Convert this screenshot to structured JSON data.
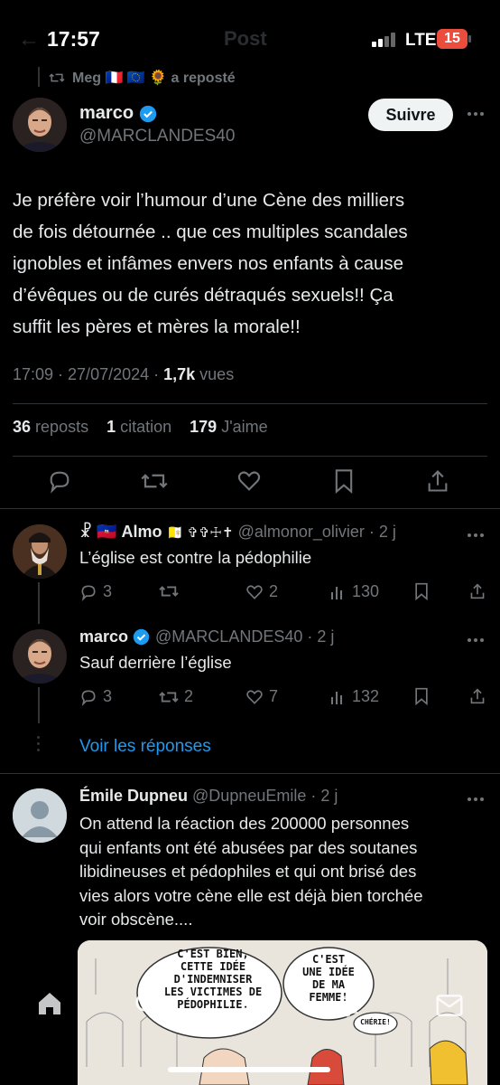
{
  "status_bar": {
    "time": "17:57",
    "network": "LTE",
    "battery": "15"
  },
  "header": {
    "title_faded": "Post"
  },
  "repost_banner": {
    "text": "Meg 🇫🇷 🇪🇺 🌻 a reposté"
  },
  "main_post": {
    "author_name": "marco",
    "author_handle": "@MARCLANDES40",
    "follow_label": "Suivre",
    "text_lines": [
      "Je préfère voir l’humour d’une Cène des milliers",
      "de fois détournée .. que ces multiples scandales",
      "ignobles et infâmes envers nos enfants à cause",
      "d’évêques ou de curés détraqués sexuels!! Ça",
      "suffit les pères et mères la morale!!"
    ],
    "timestamp": "17:09 · 27/07/2024 · ",
    "views_count": "1,7k",
    "views_label": " vues",
    "stats": {
      "reposts_count": "36",
      "reposts_label": "reposts",
      "quotes_count": "1",
      "quotes_label": "citation",
      "likes_count": "179",
      "likes_label": "J'aime"
    }
  },
  "replies": [
    {
      "prefix_emoji": "☧ 🇭🇹",
      "name": "Almo",
      "name_suffix_emoji": "🇻🇦 ✞✞☩✝",
      "handle_time": "@almonor_olivier · 2 j",
      "text": "L’église est contre la pédophilie",
      "replies_count": "3",
      "reposts_count": "",
      "likes_count": "2",
      "views_count": "130"
    },
    {
      "name": "marco",
      "handle_time": "@MARCLANDES40 · 2 j",
      "text": "Sauf derrière l’église",
      "replies_count": "3",
      "reposts_count": "2",
      "likes_count": "7",
      "views_count": "132"
    }
  ],
  "see_replies_label": "Voir les réponses",
  "third_reply": {
    "name": "Émile Dupneu",
    "handle_time": "@DupneuEmile · 2 j",
    "text_lines": [
      "On attend la réaction des 200000 personnes",
      "qui enfants ont été abusées par des soutanes",
      "libidineuses et pédophiles et qui ont brisé des",
      "vies alors votre cène  elle est déjà bien torchée",
      "voir obscène...."
    ],
    "cartoon_text_1": [
      "C'EST BIEN,",
      "CETTE IDÉE",
      "D'INDEMNISER",
      "LES VICTIMES DE",
      "PÉDOPHILIE."
    ],
    "cartoon_text_2": [
      "C'EST",
      "UNE IDÉE",
      "DE MA",
      "FEMME!"
    ],
    "cartoon_text_3": "CHÉRIE!"
  },
  "colors": {
    "accent": "#1d9bf0",
    "background": "#000000",
    "muted": "#71767b",
    "battery": "#eb4d3d"
  },
  "icons": [
    "repost-icon",
    "more-icon",
    "reply-icon",
    "like-icon",
    "bookmark-icon",
    "share-icon",
    "views-icon",
    "home-icon",
    "search-icon",
    "communities-icon",
    "messages-icon",
    "verified-badge-icon"
  ]
}
